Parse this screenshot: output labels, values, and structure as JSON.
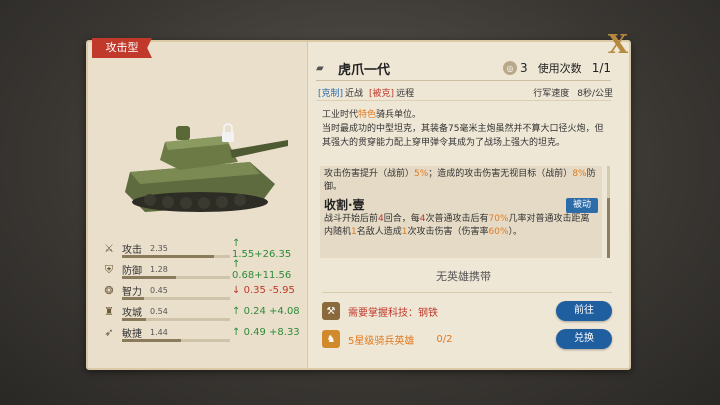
{
  "unit": {
    "category_tag": "攻击型",
    "name": "虎爪一代",
    "rank": "3",
    "uses_label": "使用次数",
    "uses_value": "1/1",
    "counter_label": "[克制]",
    "counter_value": "近战",
    "countered_label": "[被克]",
    "countered_value": "远程",
    "march_speed_label": "行军速度",
    "march_speed_value": "8秒/公里"
  },
  "description": {
    "line1_pre": "工业时代",
    "line1_hl": "特色",
    "line1_post": "骑兵单位。",
    "line2": "当时最成功的中型坦克，其装备75毫米主炮虽然并不算大口径火炮，但其强大的贯穿能力配上穿甲弹令其成为了战场上强大的坦克。"
  },
  "skill_box": {
    "prev_line_pre": "攻击伤害提升（战前）",
    "prev_line_hl": "5%",
    "prev_line_post": "；造成的攻击伤害无视目标（战前）",
    "prev_line_hl2": "8%",
    "prev_line_end": "防御。",
    "skill_title": "收割·壹",
    "skill_badge": "被动",
    "skill_text_1": "战斗开始后前",
    "skill_hl_1": "4",
    "skill_text_2": "回合，每",
    "skill_hl_2": "4",
    "skill_text_3": "次普通攻击后有",
    "skill_hl_3": "70%",
    "skill_text_4": "几率对普通攻击距离内随机",
    "skill_hl_4": "1",
    "skill_text_5": "名敌人造成",
    "skill_hl_5": "1",
    "skill_text_6": "次攻击伤害（伤害率",
    "skill_hl_6": "60%",
    "skill_text_7": "）。"
  },
  "no_hero_text": "无英雄携带",
  "requirements": [
    {
      "label": "需要掌握科技：钢铁",
      "button": "前往"
    },
    {
      "label": "5星级骑兵英雄",
      "count": "0/2",
      "button": "兑换"
    }
  ],
  "stats": [
    {
      "name": "攻击",
      "value": "2.35",
      "arrow": "↑",
      "delta": "1.55+26.35",
      "trend": "up",
      "icon": "sword-icon",
      "fill": 0.85
    },
    {
      "name": "防御",
      "value": "1.28",
      "arrow": "↑",
      "delta": "0.68+11.56",
      "trend": "up",
      "icon": "shield-icon",
      "fill": 0.5
    },
    {
      "name": "智力",
      "value": "0.45",
      "arrow": "↓",
      "delta": "0.35 -5.95",
      "trend": "down",
      "icon": "brain-icon",
      "fill": 0.2
    },
    {
      "name": "攻城",
      "value": "0.54",
      "arrow": "↑",
      "delta": "0.24 +4.08",
      "trend": "up",
      "icon": "siege-icon",
      "fill": 0.22
    },
    {
      "name": "敏捷",
      "value": "1.44",
      "arrow": "↑",
      "delta": "0.49 +8.33",
      "trend": "up",
      "icon": "agility-icon",
      "fill": 0.55
    }
  ],
  "close_symbol": "X",
  "colors": {
    "tag_red": "#c0392b",
    "button_blue": "#1f5fa0",
    "up_green": "#2e8b3a",
    "down_red": "#c0392b",
    "highlight_orange": "#e07a1f"
  }
}
